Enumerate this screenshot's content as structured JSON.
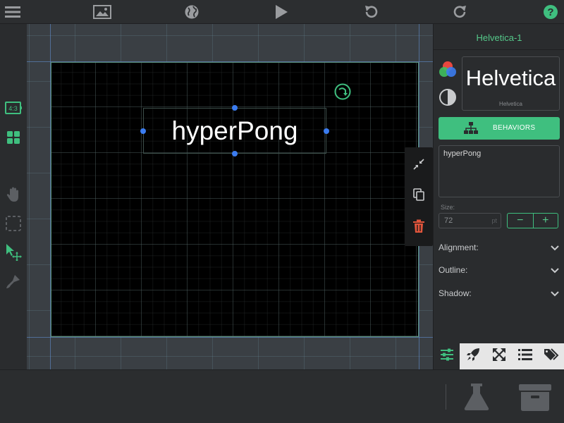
{
  "topbar": {
    "icons": [
      "menu-icon",
      "image-icon",
      "globe-icon",
      "play-icon",
      "undo-icon",
      "redo-icon",
      "help-icon"
    ]
  },
  "lefttools": {
    "aspect_label": "4:3",
    "icons": [
      "aspect-ratio-icon",
      "grid-icon",
      "hand-icon",
      "selection-icon",
      "pointer-icon",
      "brush-icon"
    ]
  },
  "canvas": {
    "text_object": "hyperPong"
  },
  "inspector": {
    "title": "Helvetica-1",
    "font_preview": "Helvetica",
    "font_preview_small": "Helvetica",
    "behaviors_label": "BEHAVIORS",
    "text_value": "hyperPong",
    "size_label": "Size:",
    "size_value": "72",
    "size_unit": "pt",
    "stepper_minus": "−",
    "stepper_plus": "+",
    "alignment_label": "Alignment:",
    "outline_label": "Outline:",
    "shadow_label": "Shadow:"
  },
  "colors": {
    "accent": "#3fbf7f",
    "delete": "#e2553c",
    "handle": "#3b7cf0"
  }
}
